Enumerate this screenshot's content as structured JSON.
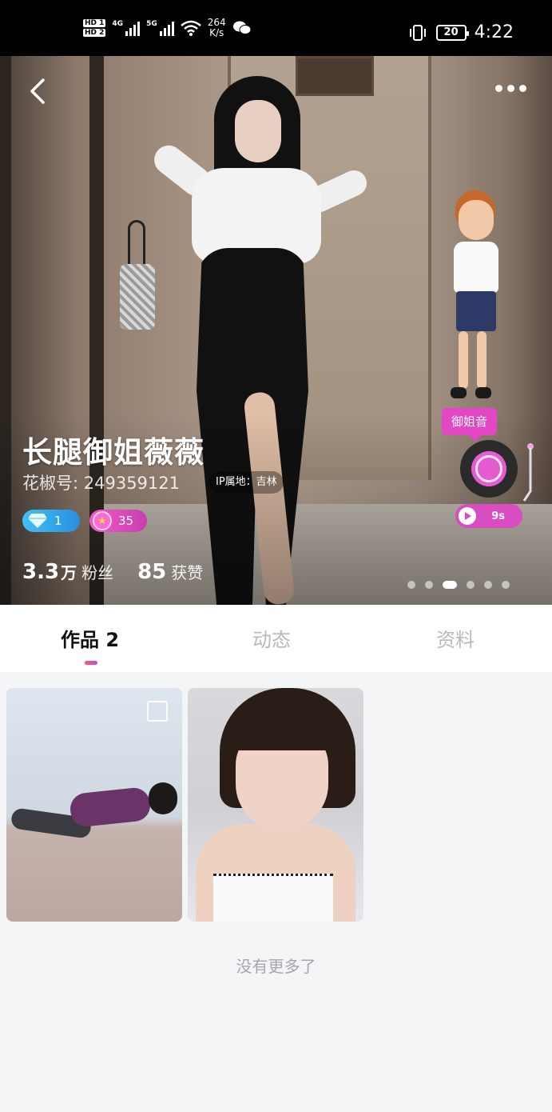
{
  "status_bar": {
    "hd1": "HD 1",
    "hd2": "HD 2",
    "net1": "4G",
    "net2": "5G",
    "speed_value": "264",
    "speed_unit": "K/s",
    "battery": "20",
    "time": "4:22",
    "icons": [
      "wifi-icon",
      "wechat-icon",
      "vibrate-icon"
    ]
  },
  "profile": {
    "name": "长腿御姐薇薇",
    "id_line": "花椒号: 249359121",
    "ip_location": "IP属地：吉林",
    "diamond_level": "1",
    "star_level": "35",
    "fans_num": "3.3",
    "fans_unit": "万",
    "fans_label": "粉丝",
    "likes_num": "85",
    "likes_label": "获赞",
    "voice_tag": "御姐音",
    "voice_duration": "9s",
    "carousel_active_index": 2,
    "carousel_count": 6
  },
  "tabs": {
    "works": "作品 2",
    "moments": "动态",
    "info": "资料",
    "active": "works"
  },
  "works": {
    "items": [
      {
        "name": "work-thumbnail-1"
      },
      {
        "name": "work-thumbnail-2"
      }
    ],
    "end_text": "没有更多了"
  },
  "colors": {
    "accent_pink": "#e447c6",
    "diamond_blue": "#3fc2f0",
    "tab_underline_start": "#ff5a5a",
    "tab_underline_end": "#c34bd8"
  }
}
